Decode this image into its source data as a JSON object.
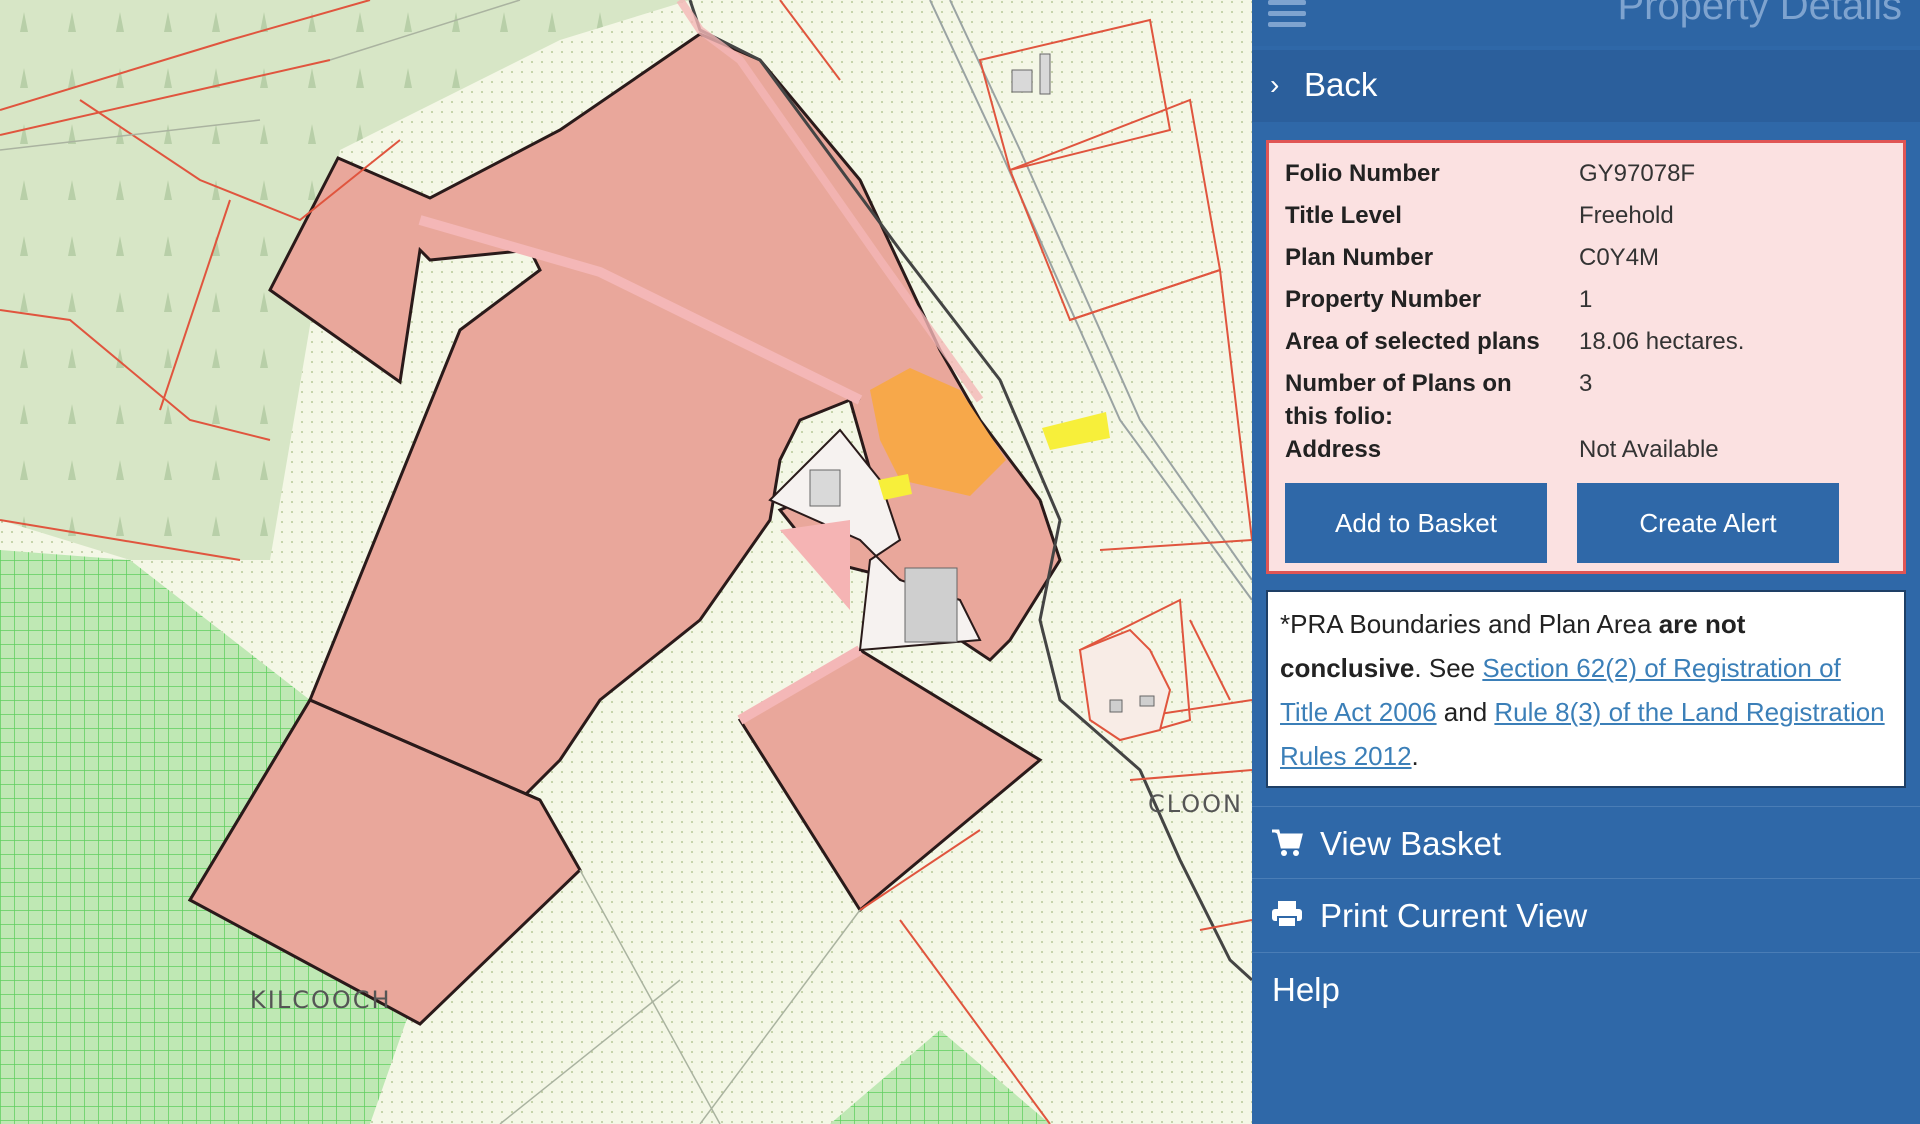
{
  "map": {
    "place_labels": [
      "CLOON",
      "KILCOOCH"
    ],
    "colors": {
      "background": "#f4f7e6",
      "forest": "#d7e6c6",
      "hatched_forest": "#8fdc8f",
      "selected_parcel": "#e9a79b",
      "selected_outline": "#2a1a1a",
      "parcel_lines": "#e0553e",
      "highlight_orange": "#f7a84a",
      "highlight_yellow": "#f7ef3a"
    }
  },
  "panel": {
    "title": "Property Details",
    "back_label": "Back",
    "details": [
      {
        "label": "Folio Number",
        "value": "GY97078F"
      },
      {
        "label": "Title Level",
        "value": "Freehold"
      },
      {
        "label": "Plan Number",
        "value": "C0Y4M"
      },
      {
        "label": "Property Number",
        "value": "1"
      },
      {
        "label": "Area of selected plans",
        "value": "18.06 hectares."
      },
      {
        "label": "Number of Plans on this folio:",
        "value": "3"
      },
      {
        "label": "Address",
        "value": "Not Available"
      }
    ],
    "add_to_basket_label": "Add to Basket",
    "create_alert_label": "Create Alert",
    "disclaimer": {
      "prefix": "*PRA Boundaries and Plan Area ",
      "bold": "are not conclusive",
      "middle": ". See ",
      "link1": "Section 62(2) of Registration of Title Act 2006",
      "and": " and ",
      "link2": "Rule 8(3) of the Land Registration Rules 2012",
      "suffix": "."
    },
    "menu": {
      "view_basket": "View Basket",
      "print_view": "Print Current View",
      "help": "Help"
    }
  }
}
